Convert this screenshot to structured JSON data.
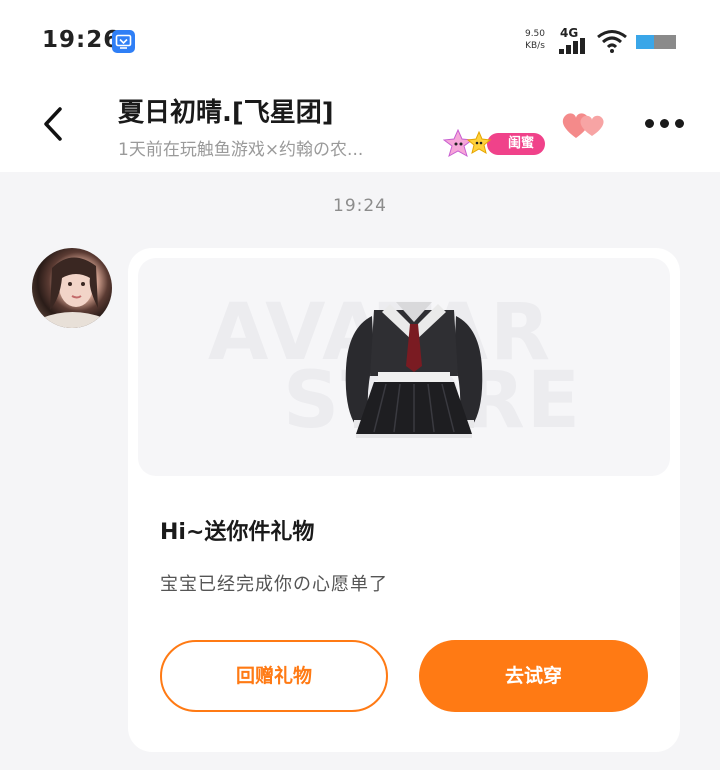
{
  "status_bar": {
    "time": "19:26",
    "net_speed_value": "9.50",
    "net_speed_unit": "KB/s",
    "network_type": "4G",
    "battery_level": 0.45
  },
  "header": {
    "title": "夏日初晴.[飞星团]",
    "subtitle": "1天前在玩触鱼游戏×约翰の农...",
    "relation_badge": "闺蜜",
    "colors": {
      "badge": "#f0428a",
      "hearts": "#f48a8a"
    }
  },
  "messages": {
    "timestamp": "19:24",
    "gift_card": {
      "image_watermark_line1": "AVATAR",
      "image_watermark_line2": "STORE",
      "title": "Hi~送你件礼物",
      "description": "宝宝已经完成你の心愿单了",
      "return_gift_label": "回赠礼物",
      "try_on_label": "去试穿",
      "accent_color": "#ff7a14"
    }
  }
}
